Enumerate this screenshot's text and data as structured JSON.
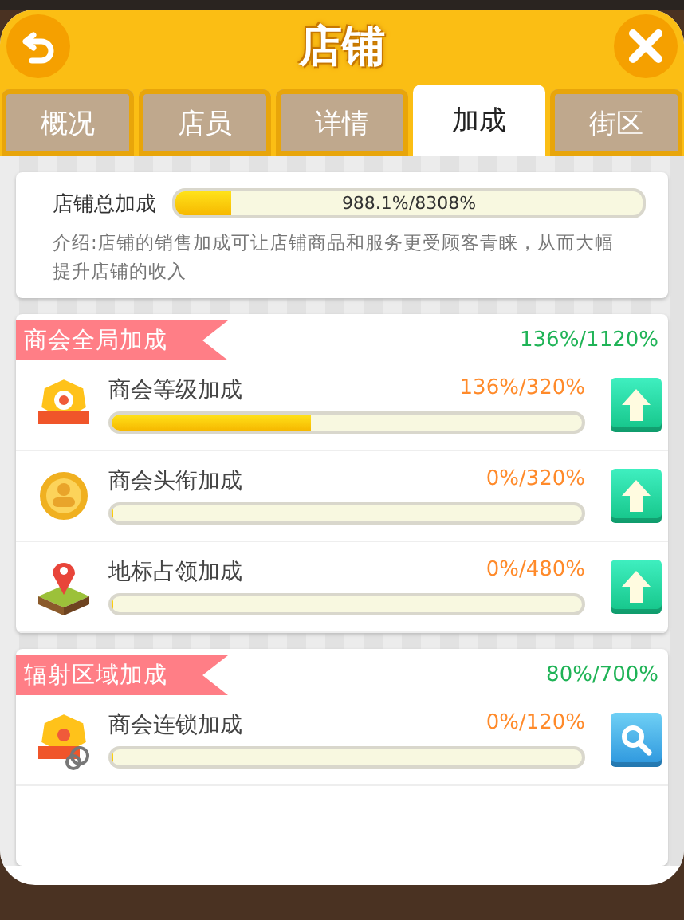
{
  "window": {
    "title": "店铺"
  },
  "tabs": [
    {
      "label": "概况",
      "selected": false
    },
    {
      "label": "店员",
      "selected": false
    },
    {
      "label": "详情",
      "selected": false
    },
    {
      "label": "加成",
      "selected": true
    },
    {
      "label": "街区",
      "selected": false
    }
  ],
  "summary": {
    "label": "店铺总加成",
    "level": 0.119,
    "reading": "988.1%/8308%",
    "description": "介绍:店铺的销售加成可让店铺商品和服务更受顾客青睐，从而大幅提升店铺的收入"
  },
  "sections": [
    {
      "title": "商会全局加成",
      "total": "136%/1120%",
      "rows": [
        {
          "kind": "medal",
          "name": "商会等级加成",
          "reading": "136%/320%",
          "level": 0.425,
          "button": {
            "kind": "upgrade"
          }
        },
        {
          "kind": "badge",
          "name": "商会头衔加成",
          "reading": "0%/320%",
          "level": 0,
          "button": {
            "kind": "upgrade"
          }
        },
        {
          "kind": "landmark",
          "name": "地标占领加成",
          "reading": "0%/480%",
          "level": 0,
          "button": {
            "kind": "upgrade"
          }
        }
      ]
    },
    {
      "title": "辐射区域加成",
      "total": "80%/700%",
      "rows": [
        {
          "kind": "chain",
          "name": "商会连锁加成",
          "reading": "0%/120%",
          "level": 0,
          "button": {
            "kind": "search"
          }
        }
      ]
    }
  ]
}
